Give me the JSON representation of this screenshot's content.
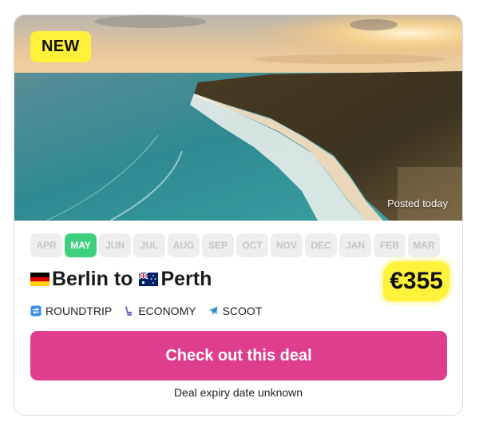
{
  "badge": {
    "label": "NEW"
  },
  "hero": {
    "posted": "Posted today"
  },
  "months": [
    {
      "label": "APR",
      "active": false
    },
    {
      "label": "MAY",
      "active": true
    },
    {
      "label": "JUN",
      "active": false
    },
    {
      "label": "JUL",
      "active": false
    },
    {
      "label": "AUG",
      "active": false
    },
    {
      "label": "SEP",
      "active": false
    },
    {
      "label": "OCT",
      "active": false
    },
    {
      "label": "NOV",
      "active": false
    },
    {
      "label": "DEC",
      "active": false
    },
    {
      "label": "JAN",
      "active": false
    },
    {
      "label": "FEB",
      "active": false
    },
    {
      "label": "MAR",
      "active": false
    }
  ],
  "route": {
    "from": "Berlin",
    "connector": "to",
    "to": "Perth",
    "from_flag": "germany-flag-icon",
    "to_flag": "australia-flag-icon"
  },
  "price": "€355",
  "tags": [
    {
      "icon": "roundtrip-icon",
      "label": "ROUNDTRIP"
    },
    {
      "icon": "seat-icon",
      "label": "ECONOMY"
    },
    {
      "icon": "airplane-icon",
      "label": "SCOOT"
    }
  ],
  "cta": {
    "label": "Check out this deal"
  },
  "expiry": "Deal expiry date unknown",
  "colors": {
    "accent": "#df3e8f",
    "active_month": "#3ecf7e",
    "highlight": "#fff23b"
  }
}
